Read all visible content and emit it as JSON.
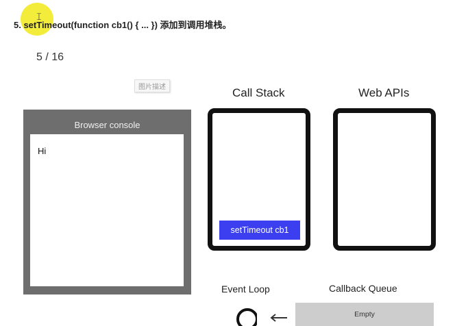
{
  "header": {
    "step_title": "5. setTimeout(function cb1() { ... }) 添加到调用堆栈。",
    "page_counter": "5 / 16",
    "image_caption": "图片描述"
  },
  "console": {
    "title": "Browser console",
    "output": "Hi"
  },
  "call_stack": {
    "title": "Call Stack",
    "frames": [
      "setTimeout cb1"
    ]
  },
  "web_apis": {
    "title": "Web APIs"
  },
  "event_loop": {
    "title": "Event Loop",
    "icon": "loop-icon"
  },
  "callback_queue": {
    "title": "Callback Queue",
    "status": "Empty",
    "arrow_icon": "arrow-left-icon"
  },
  "colors": {
    "stack_frame": "#3b3ff0",
    "console_frame": "#6e6e6e",
    "queue_bg": "#cdcdcd",
    "cursor_highlight": "#f2ea2a"
  }
}
